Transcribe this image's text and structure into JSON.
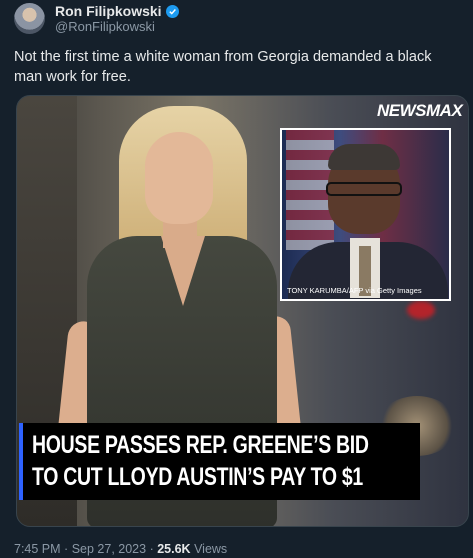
{
  "author": {
    "display_name": "Ron Filipkowski",
    "handle": "@RonFilipkowski",
    "verified": true
  },
  "tweet": {
    "text": "Not the first time a white woman from Georgia demanded a black man work for free."
  },
  "media": {
    "logo_text": "NEWSMAX",
    "inset_credit": "TONY KARUMBA/AFP via Getty Images",
    "headline_line1": "HOUSE PASSES REP. GREENE’S BID",
    "headline_line2": "TO CUT LLOYD AUSTIN’S PAY TO $1"
  },
  "meta": {
    "time": "7:45 PM",
    "separator": "·",
    "date": "Sep 27, 2023",
    "views_count": "25.6K",
    "views_label": "Views"
  },
  "colors": {
    "background": "#15202b",
    "verified_badge": "#1d9bf0",
    "banner_accent": "#2e62ff"
  }
}
